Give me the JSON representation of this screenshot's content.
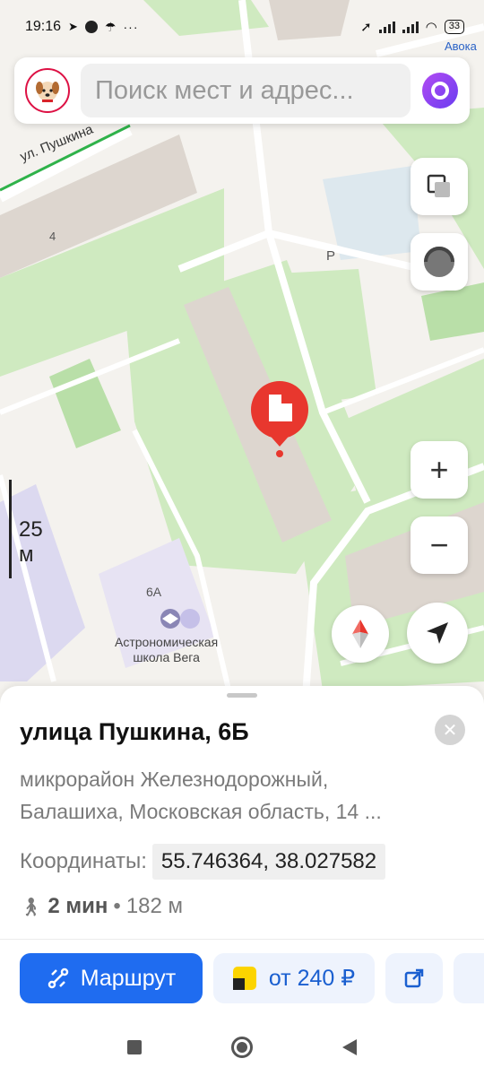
{
  "status_bar": {
    "time": "19:16",
    "battery": "33",
    "left_icons": [
      "telegram-icon",
      "vk-mail-icon",
      "umbrella-icon",
      "more-dots-icon"
    ],
    "right_icons": [
      "location-arrow-icon",
      "signal-icon",
      "signal-icon",
      "wifi-icon",
      "battery-icon"
    ]
  },
  "search": {
    "placeholder": "Поиск мест и адрес..."
  },
  "map": {
    "labels": {
      "street": "ул. Пушкина",
      "house_4": "4",
      "parking": "P",
      "house_6a": "6А",
      "school_line1": "Астрономическая",
      "school_line2": "школа Вега",
      "corner": "Авока"
    },
    "scale": "25 м",
    "colors": {
      "park": "#cfeac0",
      "building": "#ddd6cf",
      "road": "#ffffff",
      "pin": "#e8372e",
      "school": "#dcd9f0"
    }
  },
  "map_controls": {
    "layers": "layers-icon",
    "compass_left": "compass-icon",
    "zoom_in": "+",
    "zoom_out": "−",
    "locate": "locate-arrow-icon"
  },
  "place": {
    "title": "улица Пушкина, 6Б",
    "address_line1": "микрорайон Железнодорожный,",
    "address_line2": "Балашиха, Московская область, 14 ...",
    "coords_label": "Координаты:",
    "coords_value": "55.746364, 38.027582",
    "walk_time": "2 мин",
    "walk_sep": "•",
    "walk_distance": "182 м"
  },
  "actions": {
    "route_label": "Маршрут",
    "taxi_label": "от 240 ₽",
    "accent": "#1f6cf0"
  }
}
